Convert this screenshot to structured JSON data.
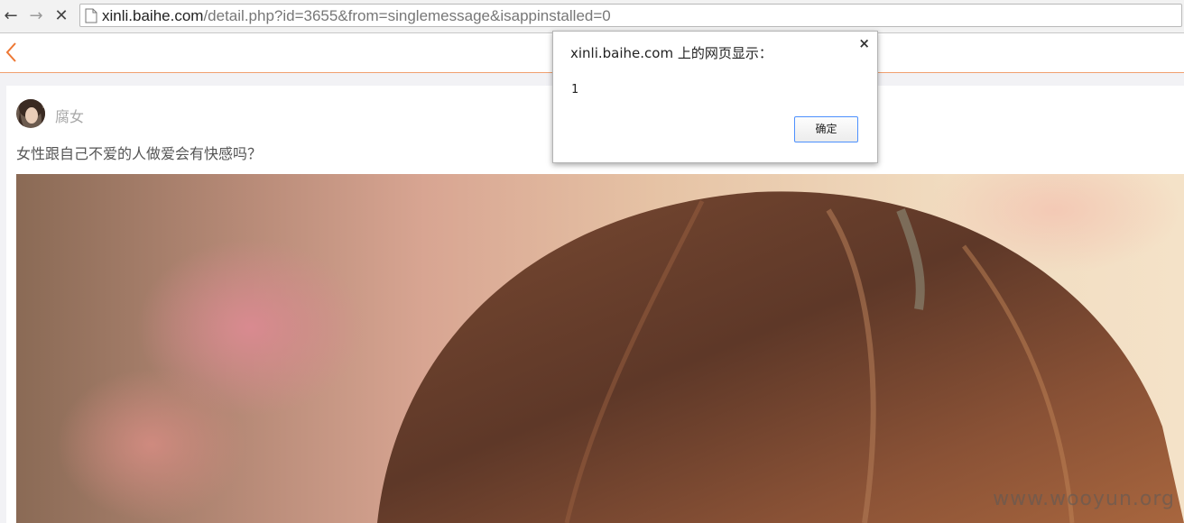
{
  "browser": {
    "url_host": "xinli.baihe.com",
    "url_path": "/detail.php?id=3655&from=singlemessage&isappinstalled=0",
    "icons": {
      "back": "arrow-left-icon",
      "forward": "arrow-right-icon",
      "stop": "close-icon",
      "page": "page-icon"
    }
  },
  "header": {
    "back_icon": "chevron-left-icon",
    "accent_color": "#f0a070"
  },
  "post": {
    "author": "腐女",
    "title": "女性跟自己不爱的人做爱会有快感吗？",
    "watermark": "www.wooyun.org"
  },
  "dialog": {
    "title": "xinli.baihe.com 上的网页显示：",
    "close_glyph": "×",
    "message": "1",
    "ok_label": "确定"
  }
}
